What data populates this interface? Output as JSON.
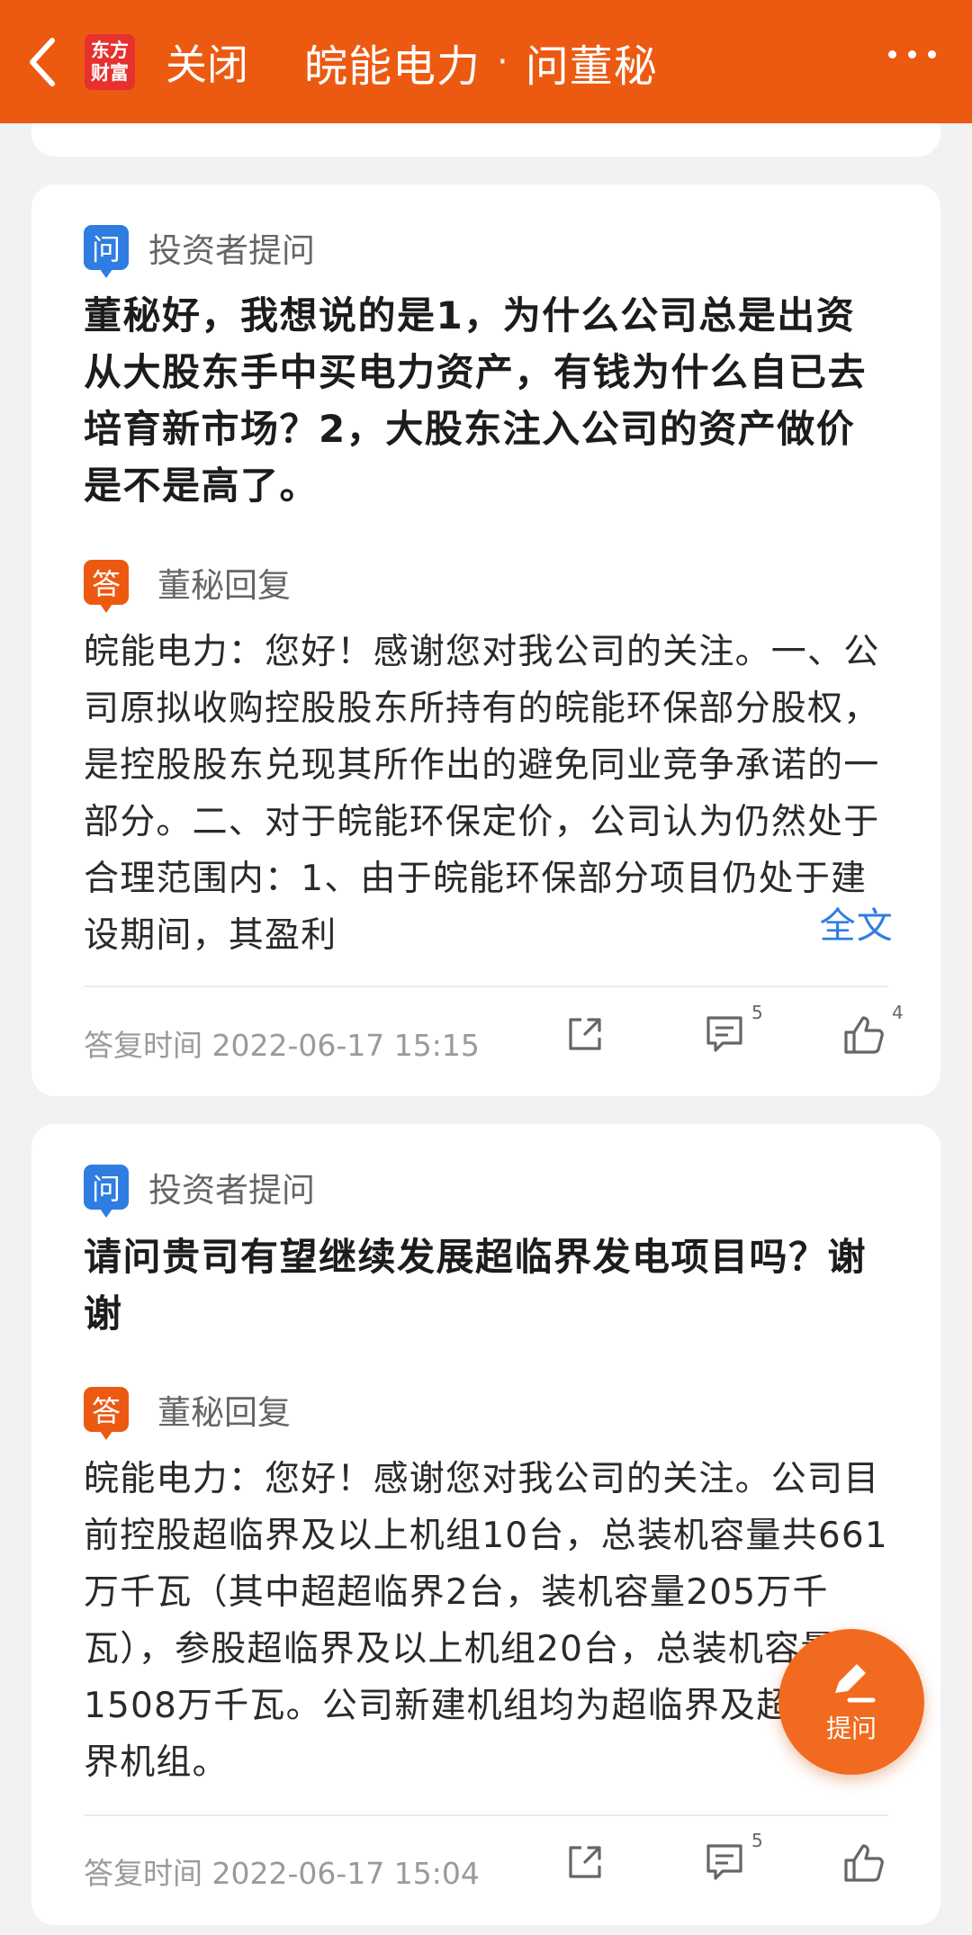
{
  "header": {
    "close_label": "关闭",
    "title_stock": "皖能电力",
    "title_separator": "·",
    "title_section": "问董秘",
    "logo_line1": "东方",
    "logo_line2": "财富"
  },
  "labels": {
    "question_badge": "问",
    "answer_badge": "答",
    "question_row": "投资者提问",
    "answer_row": "董秘回复",
    "reply_time_prefix": "答复时间",
    "full_text": "全文"
  },
  "qa": [
    {
      "question": "董秘好，我想说的是1，为什么公司总是出资从大股东手中买电力资产，有钱为什么自已去培育新市场？2，大股东注入公司的资产做价是不是高了。",
      "answer": "皖能电力：您好！感谢您对我公司的关注。一、公司原拟收购控股股东所持有的皖能环保部分股权，是控股股东兑现其所作出的避免同业竞争承诺的一部分。二、对于皖能环保定价，公司认为仍然处于合理范围内：1、由于皖能环保部分项目仍处于建设期间，其盈利",
      "reply_time": "2022-06-17 15:15",
      "comment_count": "5",
      "like_count": "4"
    },
    {
      "question": "请问贵司有望继续发展超临界发电项目吗？谢谢",
      "answer": "皖能电力：您好！感谢您对我公司的关注。公司目前控股超临界及以上机组10台，总装机容量共661万千瓦（其中超超临界2台，装机容量205万千瓦），参股超临界及以上机组20台，总装机容量共1508万千瓦。公司新建机组均为超临界及超超临界机组。",
      "reply_time": "2022-06-17 15:04",
      "comment_count": "5",
      "like_count": ""
    }
  ],
  "fab": {
    "label": "提问"
  },
  "colors": {
    "brand_orange": "#ec5a12",
    "question_blue": "#2f7de1",
    "link_blue": "#2f7de1"
  }
}
